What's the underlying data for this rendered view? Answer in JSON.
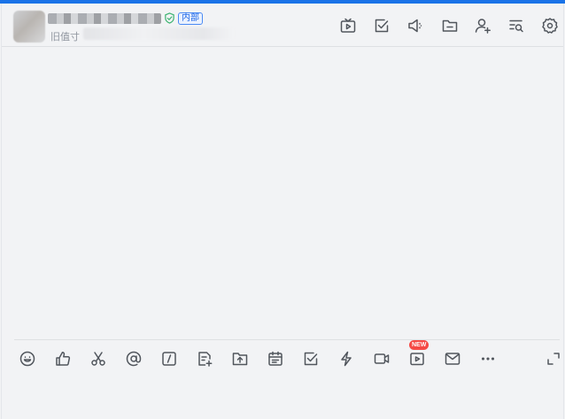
{
  "header": {
    "badge": "内部",
    "subtitle": "旧值寸"
  },
  "colors": {
    "accent_bar": "#1a73e8",
    "badge_border": "#4b8bf4",
    "new_badge": "#f54a45",
    "verified": "#3cb371"
  },
  "header_tools": [
    {
      "name": "live-icon"
    },
    {
      "name": "task-check-icon"
    },
    {
      "name": "announcement-icon"
    },
    {
      "name": "folder-icon"
    },
    {
      "name": "add-member-icon"
    },
    {
      "name": "search-history-icon"
    },
    {
      "name": "settings-gear-icon"
    }
  ],
  "editor_tools": [
    {
      "name": "emoji-icon"
    },
    {
      "name": "thumbs-up-icon"
    },
    {
      "name": "scissors-icon"
    },
    {
      "name": "mention-at-icon"
    },
    {
      "name": "slash-command-icon"
    },
    {
      "name": "new-doc-icon"
    },
    {
      "name": "upload-file-icon"
    },
    {
      "name": "calendar-icon"
    },
    {
      "name": "task-check-icon"
    },
    {
      "name": "lightning-icon"
    },
    {
      "name": "video-call-icon"
    },
    {
      "name": "video-play-icon",
      "badge": "NEW"
    },
    {
      "name": "mail-icon"
    },
    {
      "name": "more-dots-icon"
    }
  ],
  "editor": {
    "new_badge": "NEW"
  }
}
